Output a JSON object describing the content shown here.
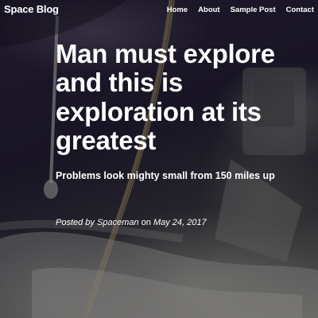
{
  "navbar": {
    "brand": "Space Blog",
    "links": [
      "Home",
      "About",
      "Sample Post",
      "Contact"
    ]
  },
  "hero": {
    "title": "Man must explore and this is exploration at its greatest",
    "subtitle": "Problems look mighty small from 150 miles up",
    "meta": {
      "posted_by": "Posted by",
      "author": "Spaceman",
      "on": "on",
      "date": "May 24, 2017"
    }
  },
  "colors": {
    "text": "#ffffff",
    "hero_dark": "#1e1a2a"
  }
}
